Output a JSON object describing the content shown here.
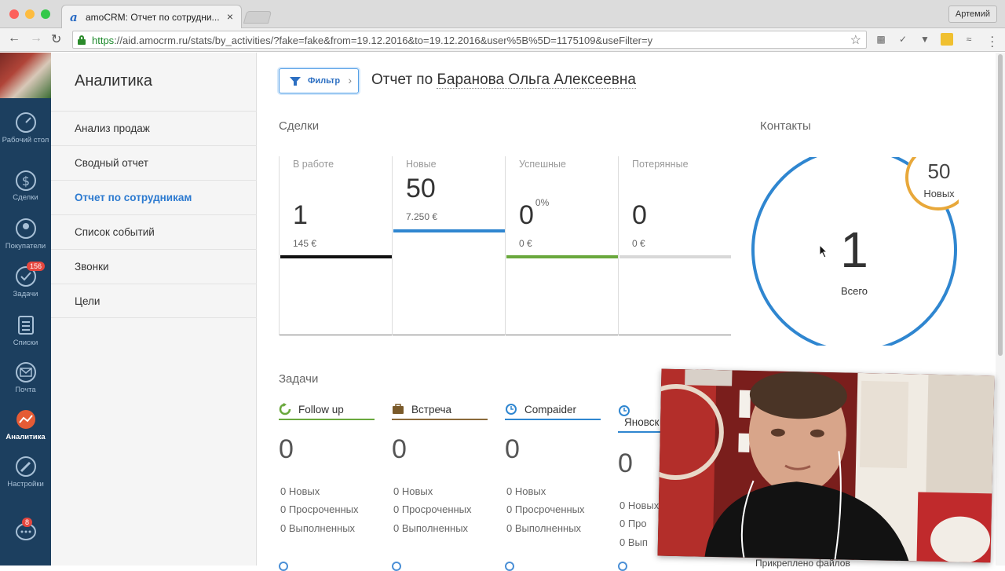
{
  "browser": {
    "tab_title": "amoCRM: Отчет по сотрудни...",
    "tab_favicon": "a",
    "tab_close": "×",
    "profile": "Артемий",
    "url_scheme": "https",
    "url_rest": "://aid.amocrm.ru/stats/by_activities/?fake=fake&from=19.12.2016&to=19.12.2016&user%5B%5D=1175109&useFilter=y"
  },
  "leftnav": {
    "items": [
      {
        "label": "Рабочий стол",
        "icon": "dashboard-icon"
      },
      {
        "label": "Сделки",
        "icon": "deals-icon"
      },
      {
        "label": "Покупатели",
        "icon": "customers-icon"
      },
      {
        "label": "Задачи",
        "icon": "tasks-icon",
        "badge": "156"
      },
      {
        "label": "Списки",
        "icon": "lists-icon"
      },
      {
        "label": "Почта",
        "icon": "mail-icon"
      },
      {
        "label": "Аналитика",
        "icon": "analytics-icon"
      },
      {
        "label": "Настройки",
        "icon": "settings-icon"
      }
    ],
    "chat_badge": "8"
  },
  "submenu": {
    "title": "Аналитика",
    "items": [
      "Анализ продаж",
      "Сводный отчет",
      "Отчет по сотрудникам",
      "Список событий",
      "Звонки",
      "Цели"
    ]
  },
  "header": {
    "filter_label": "Фильтр",
    "report_prefix": "Отчет по",
    "report_user": "Баранова Ольга Алексеевна"
  },
  "deals": {
    "title": "Сделки",
    "columns": [
      {
        "label": "В работе",
        "value": "1",
        "amount": "145 €",
        "color": "#111111"
      },
      {
        "label": "Новые",
        "value": "50",
        "amount": "7.250 €",
        "color": "#2f86d0"
      },
      {
        "label": "Успешные",
        "value": "0",
        "percent": "0%",
        "amount": "0 €",
        "color": "#6aa83d"
      },
      {
        "label": "Потерянные",
        "value": "0",
        "amount": "0 €",
        "color": "#d8d8d8"
      }
    ]
  },
  "contacts": {
    "title": "Контакты",
    "total": "1",
    "total_label": "Всего",
    "new": "50",
    "new_label": "Новых",
    "ring_color": "#2f86d0",
    "new_ring_color": "#e8a83a"
  },
  "tasks": {
    "title": "Задачи",
    "columns": [
      {
        "name": "Follow up",
        "count": "0",
        "new": "0 Новых",
        "overdue": "0 Просроченных",
        "done": "0 Выполненных",
        "color": "#6aa83d",
        "icon": "followup-icon"
      },
      {
        "name": "Встреча",
        "count": "0",
        "new": "0 Новых",
        "overdue": "0 Просроченных",
        "done": "0 Выполненных",
        "color": "#8a6a3a",
        "icon": "briefcase-icon"
      },
      {
        "name": "Compaider",
        "count": "0",
        "new": "0 Новых",
        "overdue": "0 Просроченных",
        "done": "0 Выполненных",
        "color": "#2f86d0",
        "icon": "clock-icon"
      },
      {
        "name": "Яновск",
        "count": "0",
        "new": "0 Новых",
        "overdue": "0 Про",
        "done": "0 Вып",
        "color": "#2f86d0",
        "icon": "clock-icon"
      }
    ]
  },
  "footer": {
    "attach_label": "Прикреплено файлов"
  }
}
